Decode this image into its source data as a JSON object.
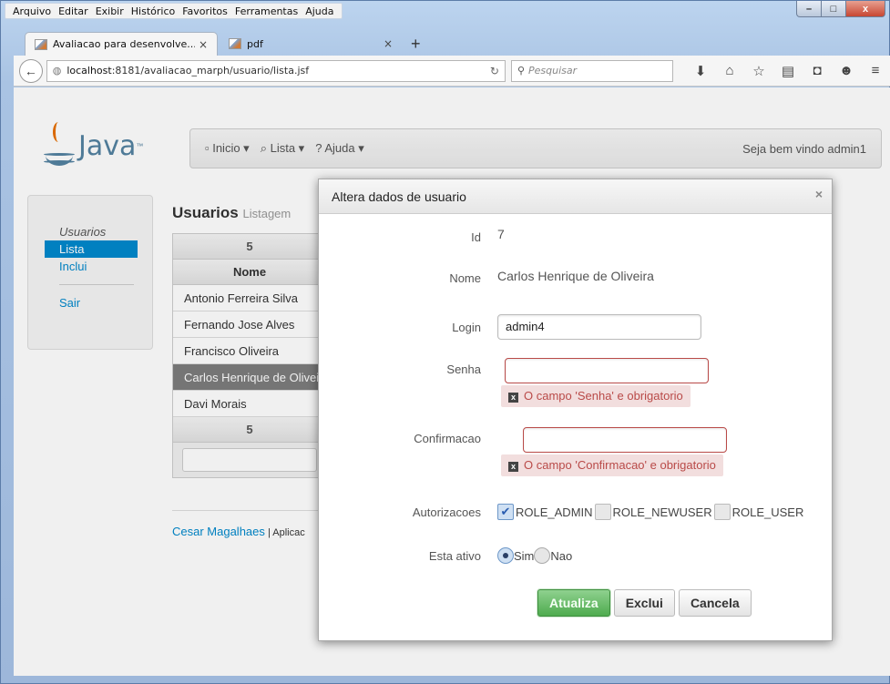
{
  "window": {
    "menu": [
      "Arquivo",
      "Editar",
      "Exibir",
      "Histórico",
      "Favoritos",
      "Ferramentas",
      "Ajuda"
    ],
    "controls": {
      "minimize": "–",
      "maximize": "□",
      "close": "x"
    }
  },
  "tabs": [
    {
      "title": "Avaliacao para desenvolve...",
      "close": "×"
    },
    {
      "title": "pdf",
      "close": "×"
    }
  ],
  "newtab_label": "+",
  "nav": {
    "url_host": "localhost",
    "url_rest": ":8181/avaliacao_marph/usuario/lista.jsf",
    "search_placeholder": "Pesquisar"
  },
  "site": {
    "logo_text": "Java",
    "logo_tm": "™",
    "topnav": [
      "▫ Inicio ▾",
      "⌕ Lista ▾",
      "? Ajuda ▾"
    ],
    "welcome": "Seja bem vindo admin1",
    "sidebar": {
      "header": "Usuarios",
      "items": [
        "Lista",
        "Inclui"
      ],
      "logout": "Sair"
    },
    "title": "Usuarios",
    "subtitle": "Listagem",
    "table": {
      "page_top": "5",
      "column": "Nome",
      "rows": [
        "Antonio Ferreira Silva",
        "Fernando Jose Alves",
        "Francisco Oliveira",
        "Carlos Henrique de Oliveira",
        "Davi Morais"
      ],
      "page_bottom": "5"
    },
    "footer_author": "Cesar Magalhaes",
    "footer_rest": " | Aplicac"
  },
  "dialog": {
    "title": "Altera dados de usuario",
    "close": "×",
    "fields": {
      "id_label": "Id",
      "id_value": "7",
      "name_label": "Nome",
      "name_value": "Carlos Henrique de Oliveira",
      "login_label": "Login",
      "login_value": "admin4",
      "password_label": "Senha",
      "password_value": "",
      "password_error": "O campo 'Senha' e obrigatorio",
      "confirm_label": "Confirmacao",
      "confirm_value": "",
      "confirm_error": "O campo 'Confirmacao' e obrigatorio",
      "roles_label": "Autorizacoes",
      "roles": [
        {
          "name": "ROLE_ADMIN",
          "checked": true
        },
        {
          "name": "ROLE_NEWUSER",
          "checked": false
        },
        {
          "name": "ROLE_USER",
          "checked": false
        }
      ],
      "active_label": "Esta ativo",
      "active_options": [
        "Sim",
        "Nao"
      ],
      "active_selected": "Sim"
    },
    "buttons": {
      "update": "Atualiza",
      "delete": "Exclui",
      "cancel": "Cancela"
    }
  },
  "colors": {
    "link": "#0088cc",
    "error": "#b94a48",
    "error_bg": "#f2dede",
    "primary_btn": "#4eab4e"
  }
}
